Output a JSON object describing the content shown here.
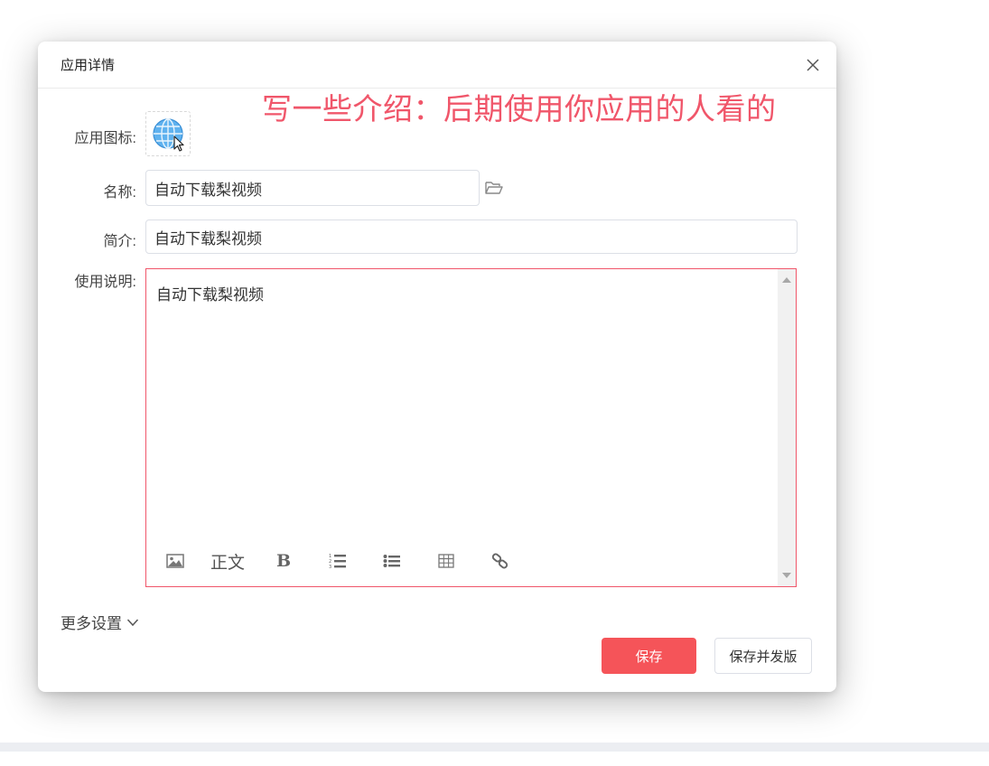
{
  "dialog": {
    "title": "应用详情"
  },
  "annotation": "写一些介绍：后期使用你应用的人看的",
  "form": {
    "icon_label": "应用图标:",
    "icon": "globe-icon",
    "name_label": "名称:",
    "name_value": "自动下载梨视频",
    "intro_label": "简介:",
    "intro_value": "自动下载梨视频",
    "usage_label": "使用说明:",
    "usage_content": "自动下载梨视频"
  },
  "editor_toolbar": {
    "image": "image-icon",
    "paragraph": "正文",
    "bold": "B",
    "ordered_list": "ordered-list-icon",
    "unordered_list": "unordered-list-icon",
    "table": "table-icon",
    "link": "link-icon"
  },
  "footer": {
    "more_settings": "更多设置",
    "save_label": "保存",
    "save_publish_label": "保存并发版"
  },
  "colors": {
    "accent": "#f55459",
    "annotation": "#f0566a",
    "editor_border": "#f0566a"
  }
}
